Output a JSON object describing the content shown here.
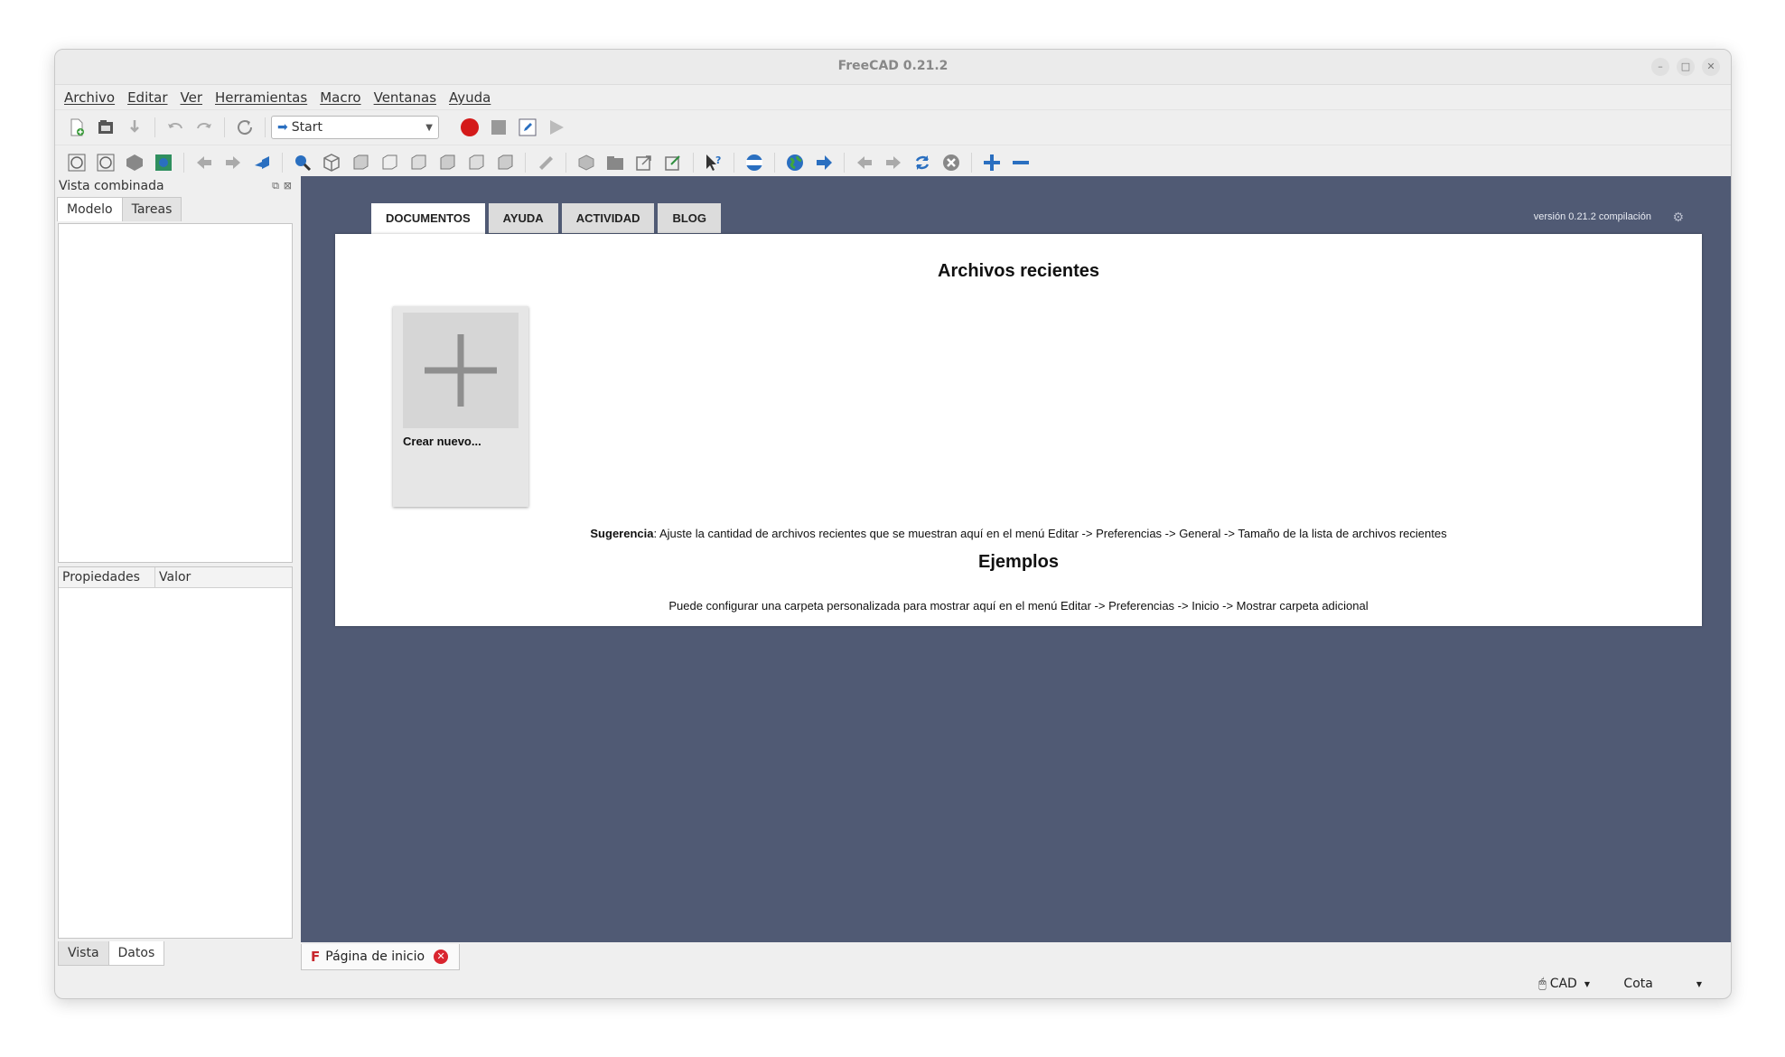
{
  "window": {
    "title": "FreeCAD 0.21.2"
  },
  "menu": {
    "items": [
      "Archivo",
      "Editar",
      "Ver",
      "Herramientas",
      "Macro",
      "Ventanas",
      "Ayuda"
    ]
  },
  "toolbar": {
    "workbench": "Start"
  },
  "combo_view": {
    "title": "Vista combinada",
    "tabs": [
      "Modelo",
      "Tareas"
    ],
    "property_headers": [
      "Propiedades",
      "Valor"
    ],
    "bottom_tabs": [
      "Vista",
      "Datos"
    ]
  },
  "start_page": {
    "tabs": [
      "DOCUMENTOS",
      "AYUDA",
      "ACTIVIDAD",
      "BLOG"
    ],
    "version_label": "versión 0.21.2 compilación",
    "recent_title": "Archivos recientes",
    "new_file_label": "Crear nuevo...",
    "hint_bold": "Sugerencia",
    "hint_text": ": Ajuste la cantidad de archivos recientes que se muestran aquí en el menú Editar -> Preferencias -> General -> Tamaño de la lista de archivos recientes",
    "examples_title": "Ejemplos",
    "examples_text": "Puede configurar una carpeta personalizada para mostrar aquí en el menú Editar -> Preferencias -> Inicio -> Mostrar carpeta adicional"
  },
  "document_tab": {
    "label": "Página de inicio"
  },
  "status": {
    "nav_style": "CAD",
    "units": "Cota"
  },
  "colors": {
    "mdi_background": "#505a74",
    "accent_blue": "#2a6fc0"
  }
}
